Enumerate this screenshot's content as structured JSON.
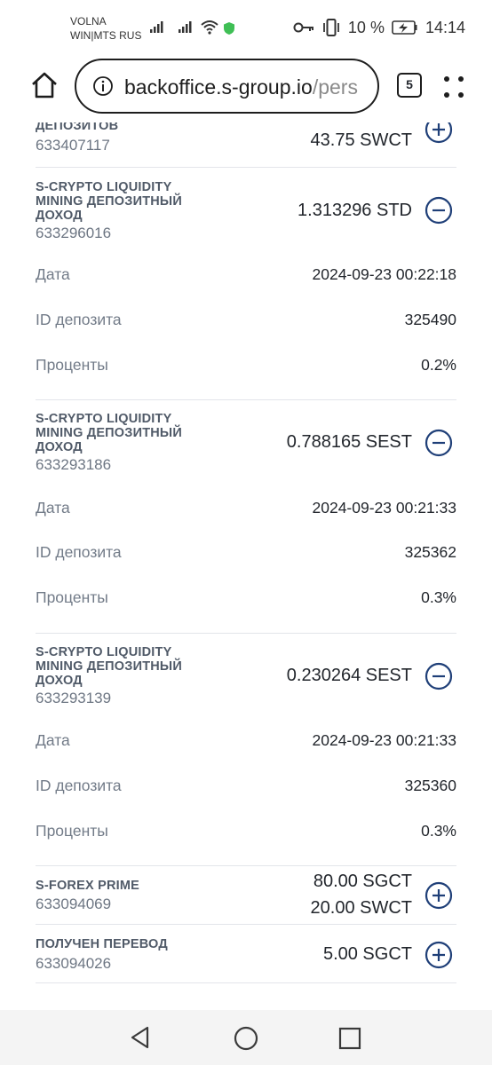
{
  "status_bar": {
    "carrier_line1": "VOLNA",
    "carrier_line2": "WIN|MTS RUS",
    "battery": "10 %",
    "time": "14:14"
  },
  "browser": {
    "url_main": "backoffice.s-group.io",
    "url_rest": "/pers",
    "tab_count": "5"
  },
  "transactions": [
    {
      "title_lines": [
        "ДЕПОЗИТОВ"
      ],
      "id": "633407117",
      "amounts": [
        "43.75 SWCT"
      ],
      "icon": "plus-circle-icon",
      "details": []
    },
    {
      "title_lines": [
        "S-CRYPTO LIQUIDITY",
        "MINING ДЕПОЗИТНЫЙ",
        "ДОХОД"
      ],
      "id": "633296016",
      "amounts": [
        "1.313296 STD"
      ],
      "icon": "minus-circle-icon",
      "details": [
        {
          "label": "Дата",
          "value": "2024-09-23 00:22:18"
        },
        {
          "label": "ID депозита",
          "value": "325490"
        },
        {
          "label": "Проценты",
          "value": "0.2%"
        }
      ]
    },
    {
      "title_lines": [
        "S-CRYPTO LIQUIDITY",
        "MINING ДЕПОЗИТНЫЙ",
        "ДОХОД"
      ],
      "id": "633293186",
      "amounts": [
        "0.788165 SEST"
      ],
      "icon": "minus-circle-icon",
      "details": [
        {
          "label": "Дата",
          "value": "2024-09-23 00:21:33"
        },
        {
          "label": "ID депозита",
          "value": "325362"
        },
        {
          "label": "Проценты",
          "value": "0.3%"
        }
      ]
    },
    {
      "title_lines": [
        "S-CRYPTO LIQUIDITY",
        "MINING ДЕПОЗИТНЫЙ",
        "ДОХОД"
      ],
      "id": "633293139",
      "amounts": [
        "0.230264 SEST"
      ],
      "icon": "minus-circle-icon",
      "details": [
        {
          "label": "Дата",
          "value": "2024-09-23 00:21:33"
        },
        {
          "label": "ID депозита",
          "value": "325360"
        },
        {
          "label": "Проценты",
          "value": "0.3%"
        }
      ]
    },
    {
      "title_lines": [
        "S-FOREX PRIME"
      ],
      "id": "633094069",
      "amounts": [
        "80.00 SGCT",
        "20.00 SWCT"
      ],
      "icon": "plus-circle-icon",
      "details": []
    },
    {
      "title_lines": [
        "ПОЛУЧЕН ПЕРЕВОД"
      ],
      "id": "633094026",
      "amounts": [
        "5.00 SGCT"
      ],
      "icon": "plus-circle-icon",
      "details": []
    }
  ],
  "colors": {
    "accent": "#1f3f78",
    "title_text": "#505a68",
    "muted_text": "#727b88",
    "divider": "#e3e5ea"
  }
}
